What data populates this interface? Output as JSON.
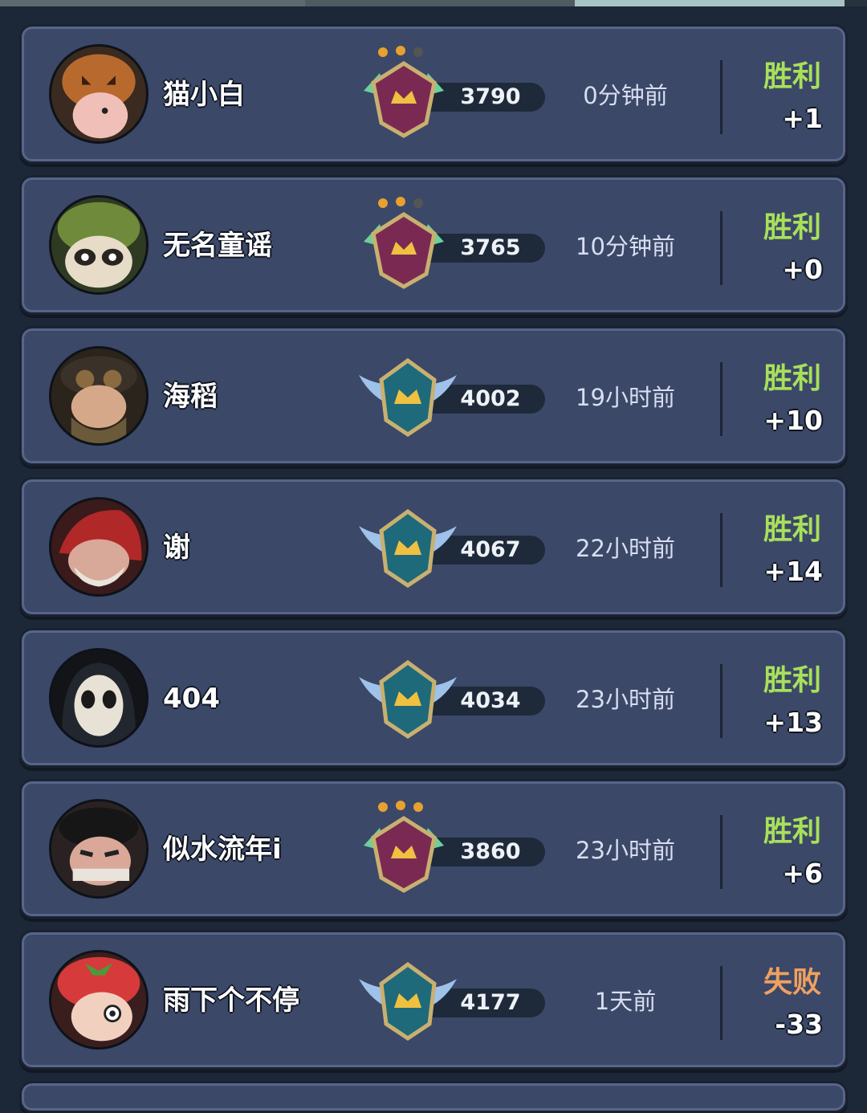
{
  "rows": [
    {
      "name": "猫小白",
      "score": "3790",
      "time": "0分钟前",
      "result": "胜利",
      "delta": "+1",
      "badge": "shield-icon",
      "avatar": "pumpkin-cat"
    },
    {
      "name": "无名童谣",
      "score": "3765",
      "time": "10分钟前",
      "result": "胜利",
      "delta": "+0",
      "badge": "shield-icon",
      "avatar": "raccoon"
    },
    {
      "name": "海稻",
      "score": "4002",
      "time": "19小时前",
      "result": "胜利",
      "delta": "+10",
      "badge": "winged-crest-icon",
      "avatar": "goggles"
    },
    {
      "name": "谢",
      "score": "4067",
      "time": "22小时前",
      "result": "胜利",
      "delta": "+14",
      "badge": "winged-crest-icon",
      "avatar": "red-hood"
    },
    {
      "name": "404",
      "score": "4034",
      "time": "23小时前",
      "result": "胜利",
      "delta": "+13",
      "badge": "winged-crest-icon",
      "avatar": "mask"
    },
    {
      "name": "似水流年i",
      "score": "3860",
      "time": "23小时前",
      "result": "胜利",
      "delta": "+6",
      "badge": "shield-icon",
      "avatar": "bandana"
    },
    {
      "name": "雨下个不停",
      "score": "4177",
      "time": "1天前",
      "result": "失败",
      "delta": "-33",
      "badge": "winged-crest-icon",
      "avatar": "strawberry"
    }
  ],
  "colors": {
    "win": "#a8e05a",
    "lose": "#f0a060",
    "card": "#3b4868",
    "background": "#1c2838"
  }
}
